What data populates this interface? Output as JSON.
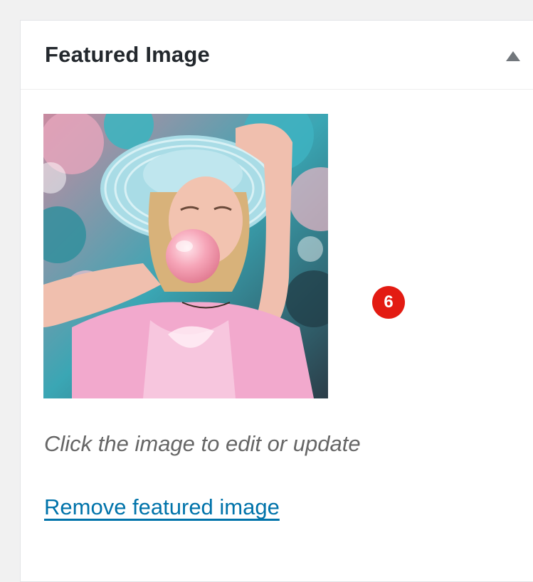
{
  "panel": {
    "title": "Featured Image",
    "toggle_icon": "triangle-up-icon"
  },
  "image": {
    "alt": "Woman in a light blue sun hat blowing a pink bubble gum bubble in front of blossoms",
    "selected": true
  },
  "badge": {
    "number": "6",
    "color": "#e31b12"
  },
  "hint_text": "Click the image to edit or update",
  "remove_link": "Remove featured image",
  "colors": {
    "link": "#0073aa",
    "title": "#23282d",
    "hint": "#666666"
  }
}
